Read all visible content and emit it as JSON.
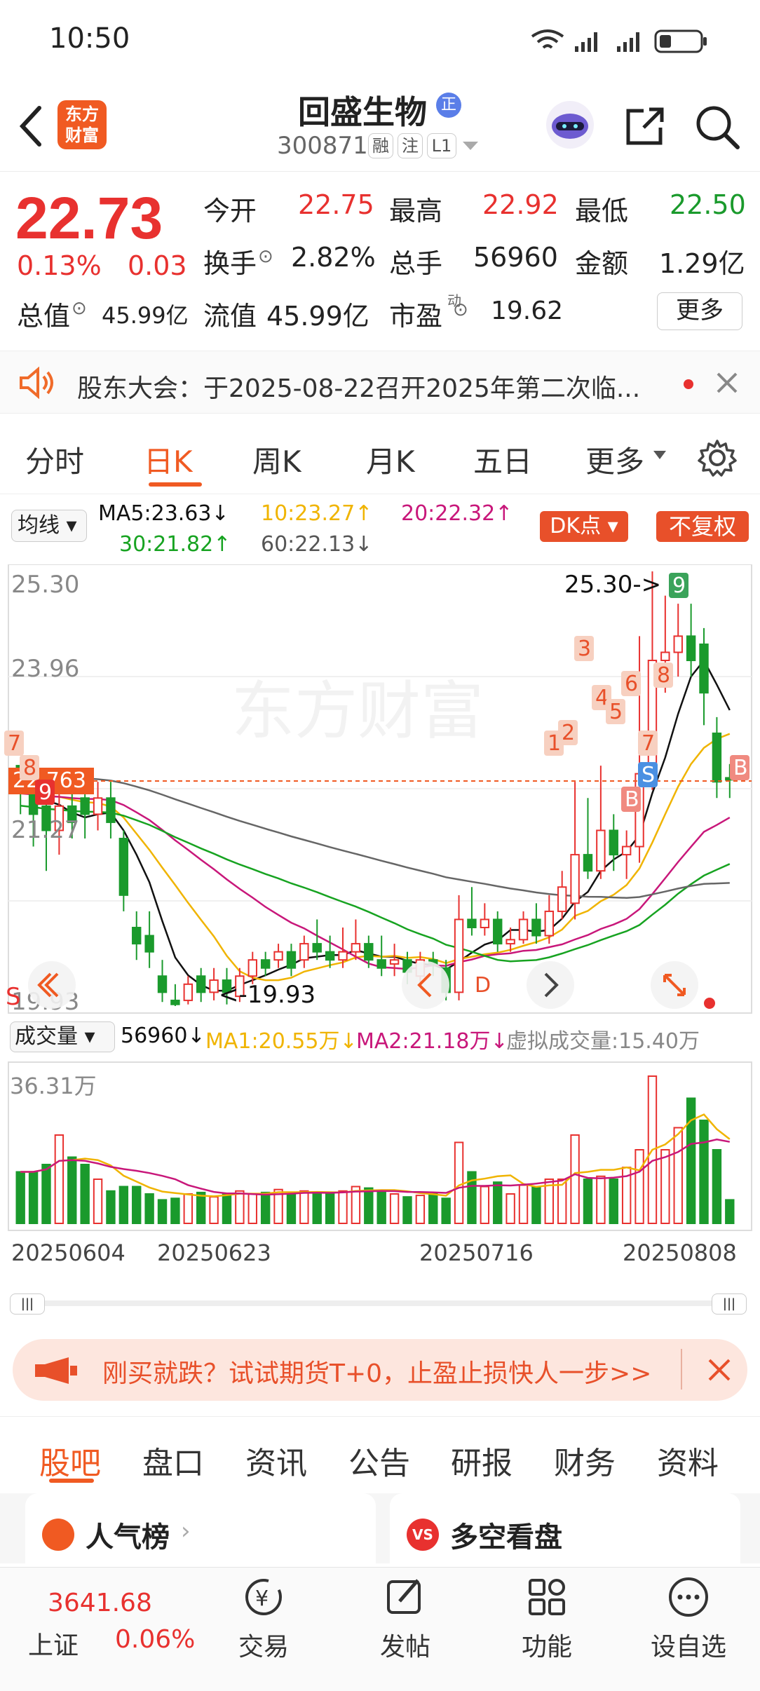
{
  "status": {
    "time": "10:50"
  },
  "header": {
    "logo_text": "东方财富",
    "stock_name": "回盛生物",
    "verified_badge": "正",
    "stock_code": "300871",
    "tags": [
      "融",
      "注",
      "L1"
    ]
  },
  "quote": {
    "price": "22.73",
    "change_pct": "0.13%",
    "change": "0.03",
    "open_label": "今开",
    "open": "22.75",
    "high_label": "最高",
    "high": "22.92",
    "low_label": "最低",
    "low": "22.50",
    "turnover_label": "换手",
    "turnover": "2.82%",
    "volume_label": "总手",
    "volume": "56960",
    "amount_label": "金额",
    "amount": "1.29亿",
    "mktcap_label": "总值",
    "mktcap": "45.99亿",
    "float_label": "流值",
    "float": "45.99亿",
    "pe_label": "市盈",
    "pe_sup": "动",
    "pe": "19.62",
    "more_label": "更多"
  },
  "notice": {
    "text": "股东大会：于2025-08-22召开2025年第二次临..."
  },
  "period_tabs": [
    "分时",
    "日K",
    "周K",
    "月K",
    "五日",
    "更多"
  ],
  "active_period": "日K",
  "ma_bar": {
    "selector": "均线",
    "ma5": "MA5:23.63↓",
    "ma10": "10:23.27↑",
    "ma20": "20:22.32↑",
    "ma30": "30:21.82↑",
    "ma60": "60:22.13↓",
    "dk_label": "DK点",
    "fq_label": "不复权"
  },
  "colors": {
    "up": "#e8312f",
    "down": "#1a9a2c",
    "ma5": "#111111",
    "ma10": "#f0b400",
    "ma20": "#c8177a",
    "ma30": "#17a321",
    "ma60": "#666666"
  },
  "kline": {
    "y_labels": [
      "25.30",
      "23.96",
      "21.27",
      "19.93"
    ],
    "current_price_label": "22.763",
    "high_annotation": "25.30->",
    "low_annotation": "<-19.93",
    "signal_labels": [
      "7",
      "8",
      "9",
      "D",
      "1",
      "2",
      "3",
      "4",
      "5",
      "6",
      "7",
      "8",
      "9",
      "S",
      "B",
      "B"
    ],
    "left_marker": "S"
  },
  "volume_bar": {
    "selector": "成交量",
    "value": "56960↓",
    "ma1": "MA1:20.55万↓",
    "ma2": "MA2:21.18万↓",
    "virtual": "虚拟成交量:15.40万",
    "top_label": "36.31万",
    "dates": [
      "20250604",
      "20250623",
      "20250716",
      "20250808"
    ]
  },
  "promo": {
    "text": "刚买就跌？试试期货T+0，止盈止损快人一步>>"
  },
  "bottom_tabs": [
    "股吧",
    "盘口",
    "资讯",
    "公告",
    "研报",
    "财务",
    "资料"
  ],
  "active_bottom_tab": "股吧",
  "cards": {
    "left": "人气榜",
    "right": "多空看盘"
  },
  "bottom_nav": {
    "index_value": "3641.68",
    "index_name": "上证",
    "index_change": "0.06%",
    "items": [
      "交易",
      "发帖",
      "功能",
      "设自选"
    ]
  }
}
